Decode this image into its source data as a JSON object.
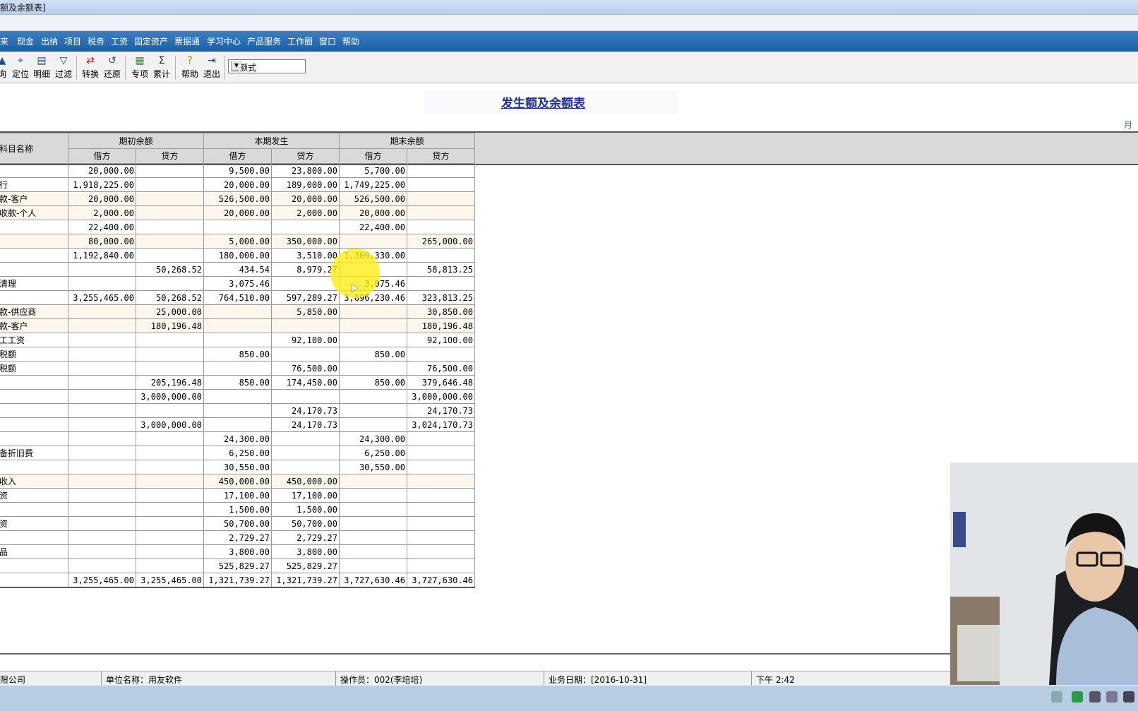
{
  "window": {
    "title": "额及余额表]"
  },
  "menu": [
    "来",
    "现金",
    "出纳",
    "项目",
    "税务",
    "工资",
    "固定资产",
    "票据通",
    "学习中心",
    "产品服务",
    "工作圈",
    "窗口",
    "帮助"
  ],
  "toolbar": {
    "buttons": [
      {
        "label": "询",
        "icon": "query-icon"
      },
      {
        "label": "定位",
        "icon": "locate-icon"
      },
      {
        "label": "明细",
        "icon": "detail-icon"
      },
      {
        "label": "过滤",
        "icon": "filter-icon"
      },
      {
        "label": "转换",
        "icon": "convert-icon"
      },
      {
        "label": "还原",
        "icon": "restore-icon"
      },
      {
        "label": "专项",
        "icon": "special-icon"
      },
      {
        "label": "累计",
        "icon": "sigma-icon"
      },
      {
        "label": "帮助",
        "icon": "help-icon"
      },
      {
        "label": "退出",
        "icon": "exit-icon"
      }
    ],
    "format_select": "金额式"
  },
  "report": {
    "title": "发生额及余额表",
    "unit_label": "月份",
    "header_name": "科目名称",
    "groups": [
      "期初余额",
      "本期发生",
      "期末余额"
    ],
    "sub": [
      "借方",
      "贷方",
      "借方",
      "贷方",
      "借方",
      "贷方"
    ],
    "rows": [
      {
        "name": "",
        "cells": [
          "20,000.00",
          "",
          "9,500.00",
          "23,800.00",
          "5,700.00",
          ""
        ]
      },
      {
        "name": "行",
        "cells": [
          "1,918,225.00",
          "",
          "20,000.00",
          "189,000.00",
          "1,749,225.00",
          ""
        ]
      },
      {
        "name": "款-客户",
        "cells": [
          "20,000.00",
          "",
          "526,500.00",
          "20,000.00",
          "526,500.00",
          ""
        ]
      },
      {
        "name": "收款-个人",
        "cells": [
          "2,000.00",
          "",
          "20,000.00",
          "2,000.00",
          "20,000.00",
          ""
        ]
      },
      {
        "name": "",
        "cells": [
          "22,400.00",
          "",
          "",
          "",
          "22,400.00",
          ""
        ]
      },
      {
        "name": "",
        "cells": [
          "80,000.00",
          "",
          "5,000.00",
          "350,000.00",
          "",
          "265,000.00"
        ]
      },
      {
        "name": "",
        "cells": [
          "1,192,840.00",
          "",
          "180,000.00",
          "3,510.00",
          "1,369,330.00",
          ""
        ]
      },
      {
        "name": "",
        "cells": [
          "",
          "50,268.52",
          "434.54",
          "8,979.27",
          "",
          "58,813.25"
        ]
      },
      {
        "name": "清理",
        "cells": [
          "",
          "",
          "3,075.46",
          "",
          "3,075.46",
          ""
        ]
      },
      {
        "name": "",
        "cells": [
          "3,255,465.00",
          "50,268.52",
          "764,510.00",
          "597,289.27",
          "3,696,230.46",
          "323,813.25"
        ]
      },
      {
        "name": "款-供应商",
        "cells": [
          "",
          "25,000.00",
          "",
          "5,850.00",
          "",
          "30,850.00"
        ]
      },
      {
        "name": "款-客户",
        "cells": [
          "",
          "180,196.48",
          "",
          "",
          "",
          "180,196.48"
        ]
      },
      {
        "name": "工工资",
        "cells": [
          "",
          "",
          "",
          "92,100.00",
          "",
          "92,100.00"
        ]
      },
      {
        "name": "税额",
        "cells": [
          "",
          "",
          "850.00",
          "",
          "850.00",
          ""
        ]
      },
      {
        "name": "税额",
        "cells": [
          "",
          "",
          "",
          "76,500.00",
          "",
          "76,500.00"
        ]
      },
      {
        "name": "",
        "cells": [
          "",
          "205,196.48",
          "850.00",
          "174,450.00",
          "850.00",
          "379,646.48"
        ]
      },
      {
        "name": "",
        "cells": [
          "",
          "3,000,000.00",
          "",
          "",
          "",
          "3,000,000.00"
        ]
      },
      {
        "name": "",
        "cells": [
          "",
          "",
          "",
          "24,170.73",
          "",
          "24,170.73"
        ]
      },
      {
        "name": "",
        "cells": [
          "",
          "3,000,000.00",
          "",
          "24,170.73",
          "",
          "3,024,170.73"
        ]
      },
      {
        "name": "",
        "cells": [
          "",
          "",
          "24,300.00",
          "",
          "24,300.00",
          ""
        ]
      },
      {
        "name": "备折旧费",
        "cells": [
          "",
          "",
          "6,250.00",
          "",
          "6,250.00",
          ""
        ]
      },
      {
        "name": "",
        "cells": [
          "",
          "",
          "30,550.00",
          "",
          "30,550.00",
          ""
        ]
      },
      {
        "name": "收入",
        "cells": [
          "",
          "",
          "450,000.00",
          "450,000.00",
          "",
          ""
        ]
      },
      {
        "name": "资",
        "cells": [
          "",
          "",
          "17,100.00",
          "17,100.00",
          "",
          ""
        ]
      },
      {
        "name": "",
        "cells": [
          "",
          "",
          "1,500.00",
          "1,500.00",
          "",
          ""
        ]
      },
      {
        "name": "资",
        "cells": [
          "",
          "",
          "50,700.00",
          "50,700.00",
          "",
          ""
        ]
      },
      {
        "name": "",
        "cells": [
          "",
          "",
          "2,729.27",
          "2,729.27",
          "",
          ""
        ]
      },
      {
        "name": "品",
        "cells": [
          "",
          "",
          "3,800.00",
          "3,800.00",
          "",
          ""
        ]
      },
      {
        "name": "",
        "cells": [
          "",
          "",
          "525,829.27",
          "525,829.27",
          "",
          ""
        ]
      },
      {
        "name": "",
        "cells": [
          "3,255,465.00",
          "3,255,465.00",
          "1,321,739.27",
          "1,321,739.27",
          "3,727,630.46",
          "3,727,630.46"
        ]
      }
    ]
  },
  "status": {
    "company": "限公司",
    "unit_name": "单位名称：用友软件",
    "operator": "操作员：002(李培培)",
    "biz_date": "业务日期：[2016-10-31]",
    "time": "下午 2:42"
  },
  "colors": {
    "menubar": "#1c5fa6",
    "row_alt": "#fdf6ec",
    "title": "#1f2f8f"
  }
}
